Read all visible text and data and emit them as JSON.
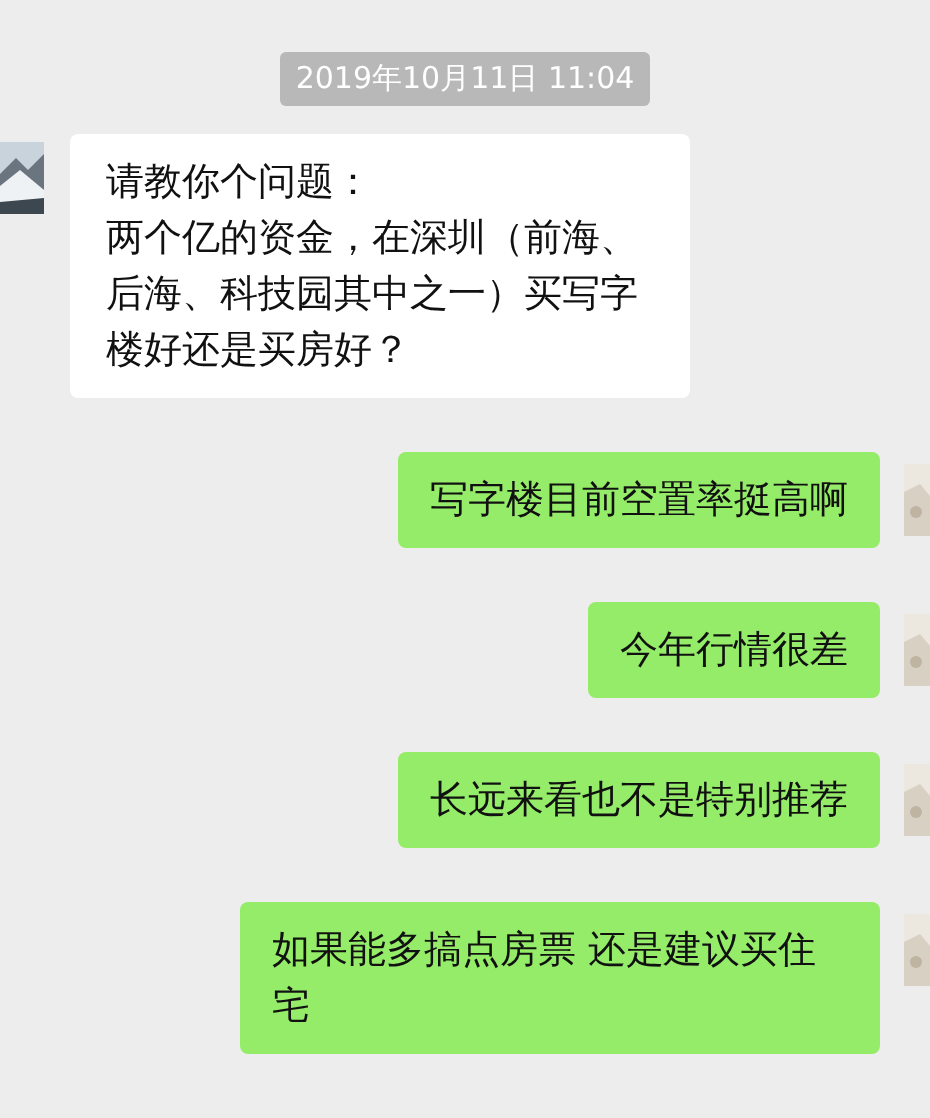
{
  "timestamp": "2019年10月11日 11:04",
  "messages": [
    {
      "kind": "received",
      "paragraphs": [
        "请教你个问题：",
        "两个亿的资金，在深圳（前海、后海、科技园其中之一）买写字楼好还是买房好？"
      ]
    },
    {
      "kind": "sent",
      "paragraphs": [
        "写字楼目前空置率挺高啊"
      ]
    },
    {
      "kind": "sent",
      "paragraphs": [
        "今年行情很差"
      ]
    },
    {
      "kind": "sent",
      "paragraphs": [
        "长远来看也不是特别推荐"
      ]
    },
    {
      "kind": "sent",
      "paragraphs": [
        "如果能多搞点房票 还是建议买住宅"
      ]
    }
  ]
}
